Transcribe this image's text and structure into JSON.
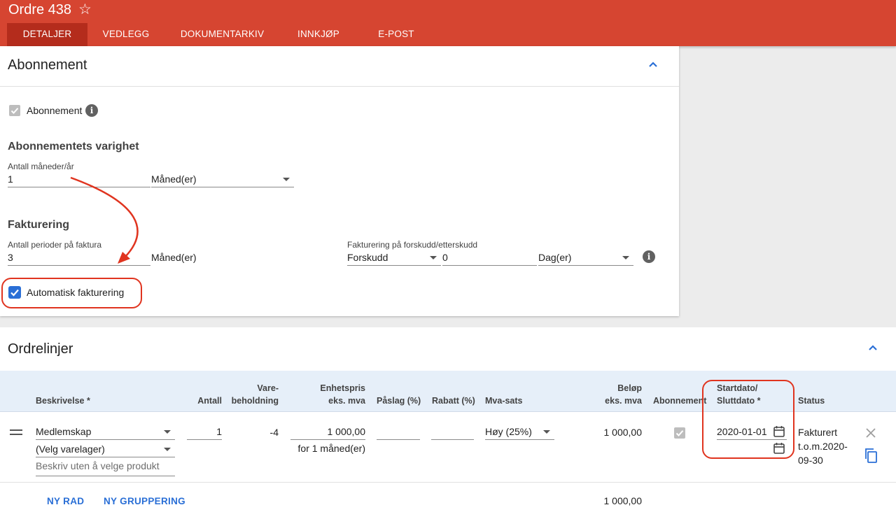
{
  "header": {
    "title": "Ordre 438",
    "tabs": [
      {
        "label": "DETALJER"
      },
      {
        "label": "VEDLEGG"
      },
      {
        "label": "DOKUMENTARKIV"
      },
      {
        "label": "INNKJØP"
      },
      {
        "label": "E-POST"
      }
    ]
  },
  "subscription": {
    "title": "Abonnement",
    "checkbox_label": "Abonnement",
    "duration_heading": "Abonnementets varighet",
    "months_label": "Antall måneder/år",
    "months_value": "1",
    "unit_value": "Måned(er)",
    "billing_heading": "Fakturering",
    "periods_label": "Antall perioder på faktura",
    "periods_value": "3",
    "periods_unit": "Måned(er)",
    "advance_label": "Fakturering på forskudd/etterskudd",
    "advance_value": "Forskudd",
    "days_value": "0",
    "days_unit": "Dag(er)",
    "auto_billing_label": "Automatisk fakturering"
  },
  "order_lines": {
    "title": "Ordrelinjer",
    "columns": {
      "description": "Beskrivelse *",
      "quantity": "Antall",
      "stock_1": "Vare-",
      "stock_2": "beholdning",
      "unit_price_1": "Enhetspris",
      "unit_price_2": "eks. mva",
      "markup": "Påslag (%)",
      "discount": "Rabatt (%)",
      "vat": "Mva-sats",
      "amount_1": "Beløp",
      "amount_2": "eks. mva",
      "subscription": "Abonnement",
      "dates_1": "Startdato/",
      "dates_2": "Sluttdato *",
      "status": "Status"
    },
    "row": {
      "product": "Medlemskap",
      "warehouse": "(Velg varelager)",
      "description_placeholder": "Beskriv uten å velge produkt",
      "quantity": "1",
      "stock": "-4",
      "unit_price": "1 000,00",
      "per_period": "for 1 måned(er)",
      "vat": "Høy (25%)",
      "amount": "1 000,00",
      "start_date": "2020-01-01",
      "status_1": "Fakturert",
      "status_2": "t.o.m.2020-",
      "status_3": "09-30"
    },
    "new_row_label": "NY RAD",
    "new_group_label": "NY GRUPPERING",
    "total": "1 000,00"
  },
  "colors": {
    "header": "#d64531",
    "active_tab": "#b42c1c",
    "accent_blue": "#2a6fd6",
    "highlight_red": "#e0341f"
  }
}
